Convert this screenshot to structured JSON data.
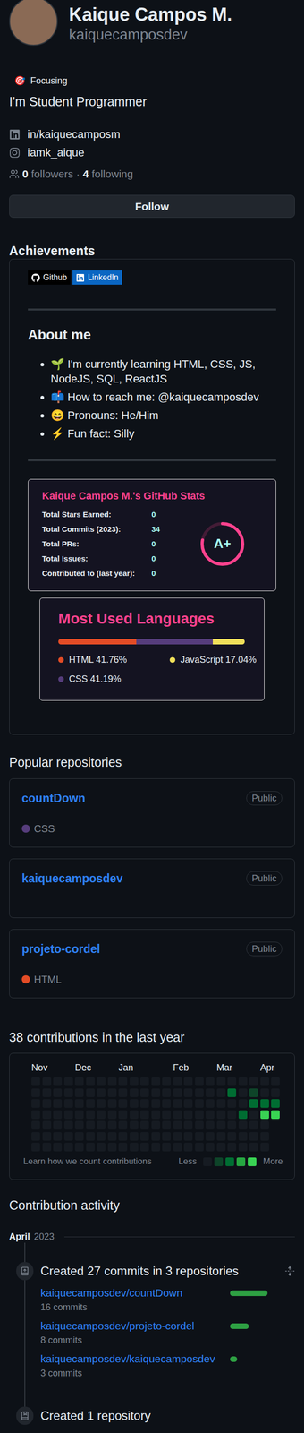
{
  "profile": {
    "name": "Kaique Campos M.",
    "username": "kaiquecamposdev",
    "status": {
      "emoji": "🎯",
      "text": "Focusing"
    },
    "bio": "I'm Student Programmer",
    "links": [
      {
        "kind": "linkedin",
        "text": "in/kaiquecamposm"
      },
      {
        "kind": "instagram",
        "text": "iamk_aique"
      }
    ],
    "followers": "0",
    "followers_label": "followers",
    "separator": "·",
    "following": "4",
    "following_label": "following",
    "follow_button": "Follow"
  },
  "achievements": {
    "title": "Achievements"
  },
  "readme": {
    "badges": [
      {
        "kind": "github",
        "label": "Github",
        "color": "#000000"
      },
      {
        "kind": "linkedin",
        "label": "LinkedIn",
        "color": "#0a66c2"
      }
    ],
    "about_title": "About me",
    "about_items": [
      {
        "emoji": "🌱",
        "text": "I'm currently learning HTML, CSS, JS, NodeJS, SQL, ReactJS"
      },
      {
        "emoji": "📫",
        "text": "How to reach me: @kaiquecamposdev"
      },
      {
        "emoji": "😄",
        "text": "Pronouns: He/Him"
      },
      {
        "emoji": "⚡",
        "text": "Fun fact: Silly"
      }
    ],
    "stats": {
      "title": "Kaique Campos M.'s GitHub Stats",
      "rows": [
        {
          "label": "Total Stars Earned:",
          "value": "0"
        },
        {
          "label": "Total Commits (2023):",
          "value": "34"
        },
        {
          "label": "Total PRs:",
          "value": "0"
        },
        {
          "label": "Total Issues:",
          "value": "0"
        },
        {
          "label": "Contributed to (last year):",
          "value": "0"
        }
      ],
      "rank": "A+",
      "rank_level": 0.78
    },
    "languages": {
      "title": "Most Used Languages",
      "items": [
        {
          "name": "HTML",
          "reading": "41.76%",
          "share": 0.4176,
          "color": "#e34c26"
        },
        {
          "name": "CSS",
          "reading": "41.19%",
          "share": 0.4119,
          "color": "#563d7c"
        },
        {
          "name": "JavaScript",
          "reading": "17.04%",
          "share": 0.1704,
          "color": "#f1e05a"
        }
      ]
    }
  },
  "popular": {
    "title": "Popular repositories",
    "repos": [
      {
        "name": "countDown",
        "visibility": "Public",
        "language": "CSS",
        "color": "#563d7c"
      },
      {
        "name": "kaiquecamposdev",
        "visibility": "Public"
      },
      {
        "name": "projeto-cordel",
        "visibility": "Public",
        "language": "HTML",
        "color": "#e34c26"
      }
    ]
  },
  "contributions": {
    "title": "38 contributions in the last year",
    "months": [
      {
        "label": "Nov",
        "week": 0
      },
      {
        "label": "Dec",
        "week": 4
      },
      {
        "label": "Jan",
        "week": 8
      },
      {
        "label": "Feb",
        "week": 13
      },
      {
        "label": "Mar",
        "week": 17
      },
      {
        "label": "Apr",
        "week": 21
      }
    ],
    "weeks": [
      [
        0,
        0,
        0,
        0,
        0,
        0,
        0
      ],
      [
        0,
        0,
        0,
        0,
        0,
        0,
        0
      ],
      [
        0,
        0,
        0,
        0,
        0,
        0,
        0
      ],
      [
        0,
        0,
        0,
        0,
        0,
        0,
        0
      ],
      [
        0,
        0,
        0,
        0,
        0,
        0,
        0
      ],
      [
        0,
        0,
        0,
        0,
        0,
        0,
        0
      ],
      [
        0,
        0,
        0,
        0,
        0,
        0,
        0
      ],
      [
        0,
        0,
        0,
        0,
        0,
        0,
        0
      ],
      [
        0,
        0,
        0,
        0,
        0,
        0,
        0
      ],
      [
        0,
        0,
        0,
        0,
        0,
        0,
        0
      ],
      [
        0,
        0,
        0,
        0,
        0,
        0,
        0
      ],
      [
        0,
        0,
        0,
        0,
        0,
        0,
        0
      ],
      [
        0,
        0,
        0,
        0,
        0,
        0,
        0
      ],
      [
        0,
        0,
        0,
        0,
        0,
        0,
        0
      ],
      [
        0,
        0,
        0,
        0,
        0,
        0,
        0
      ],
      [
        0,
        0,
        0,
        0,
        0,
        0,
        0
      ],
      [
        0,
        0,
        0,
        0,
        0,
        0,
        0
      ],
      [
        0,
        0,
        0,
        0,
        0,
        0,
        0
      ],
      [
        0,
        2,
        0,
        0,
        0,
        0,
        0
      ],
      [
        0,
        0,
        0,
        2,
        0,
        0,
        0
      ],
      [
        0,
        1,
        2,
        0,
        0,
        0,
        0
      ],
      [
        0,
        0,
        2,
        4,
        0,
        0,
        0
      ],
      [
        0,
        0,
        2,
        4
      ]
    ],
    "learn": "Learn how we count contributions",
    "less": "Less",
    "more": "More",
    "legend_levels": [
      0,
      1,
      2,
      3,
      4
    ]
  },
  "activity": {
    "title": "Contribution activity",
    "month": "April",
    "year": "2023",
    "events": [
      {
        "kind": "commits",
        "title": "Created 27 commits in 3 repositories",
        "items": [
          {
            "repo": "kaiquecamposdev/countDown",
            "count": "16 commits",
            "level": 1
          },
          {
            "repo": "kaiquecamposdev/projeto-cordel",
            "count": "8 commits",
            "level": 0.5
          },
          {
            "repo": "kaiquecamposdev/kaiquecamposdev",
            "count": "3 commits",
            "level": 0.19
          }
        ]
      },
      {
        "kind": "repository",
        "title": "Created 1 repository",
        "items": []
      }
    ]
  }
}
